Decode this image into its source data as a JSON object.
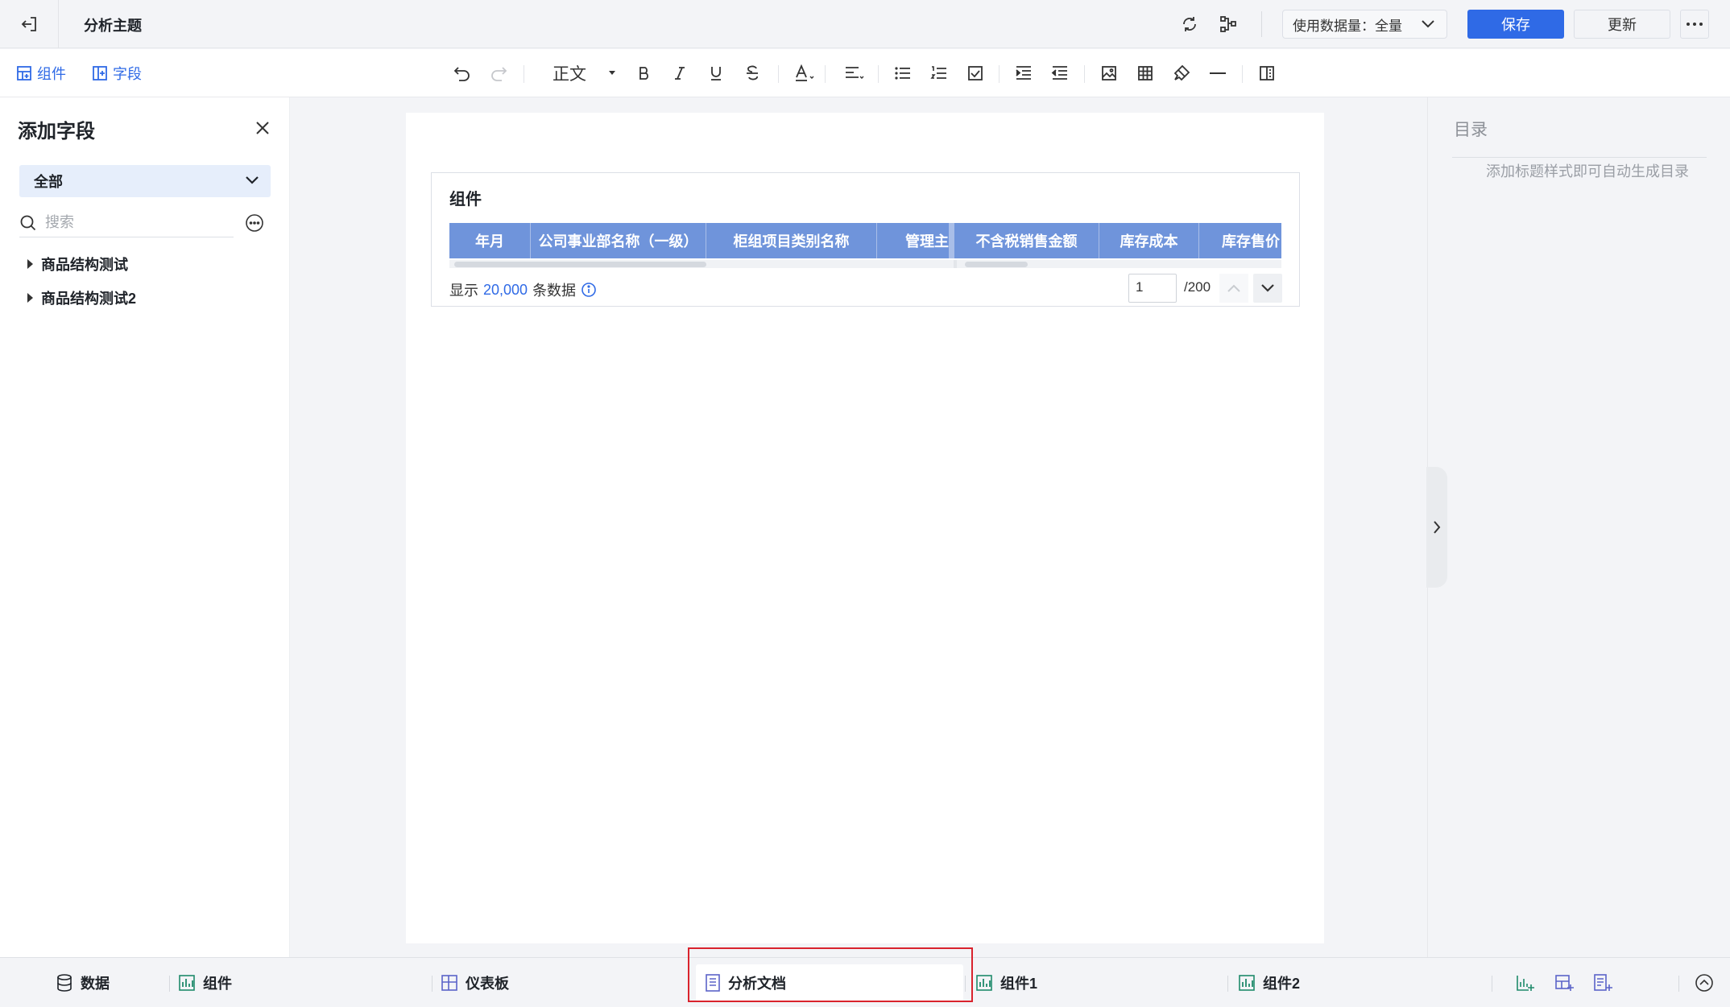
{
  "header": {
    "title": "分析主题",
    "data_volume_label": "使用数据量：全量",
    "save_label": "保存",
    "update_label": "更新"
  },
  "toolbar": {
    "tabs": [
      "组件",
      "字段"
    ],
    "text_style": "正文",
    "tool_icons": [
      "undo-icon",
      "redo-icon",
      "bold-icon",
      "italic-icon",
      "underline-icon",
      "strikethrough-icon",
      "font-color-icon",
      "align-icon",
      "bullet-list-icon",
      "numbered-list-icon",
      "checklist-icon",
      "indent-icon",
      "outdent-icon",
      "image-icon",
      "table-icon",
      "format-painter-icon",
      "horizontal-rule-icon",
      "page-break-icon"
    ]
  },
  "left_panel": {
    "title": "添加字段",
    "filter_value": "全部",
    "search_placeholder": "搜索",
    "tree": [
      "商品结构测试",
      "商品结构测试2"
    ]
  },
  "widget": {
    "title": "组件",
    "columns": [
      "年月",
      "公司事业部名称（一级）",
      "柜组项目类别名称",
      "管理主",
      "不含税销售金额",
      "库存成本",
      "库存售价"
    ],
    "row_count_prefix": "显示",
    "row_count": "20,000",
    "row_count_suffix": "条数据",
    "page_value": "1",
    "page_total": "/200"
  },
  "toc": {
    "title": "目录",
    "hint": "添加标题样式即可自动生成目录"
  },
  "bottom_tabs": {
    "data": "数据",
    "component": "组件",
    "dashboard": "仪表板",
    "analysis_doc": "分析文档",
    "component1": "组件1",
    "component2": "组件2"
  },
  "colors": {
    "accent": "#2f6ae6",
    "header_fill": "#6f94db",
    "highlight": "#d9232d"
  }
}
